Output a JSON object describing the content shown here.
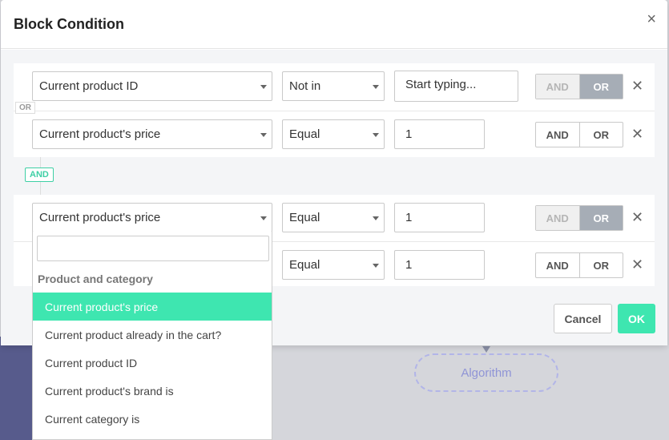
{
  "background": {
    "node_label": "Algorithm"
  },
  "modal": {
    "title": "Block Condition",
    "close_glyph": "×",
    "groups": [
      {
        "rows": [
          {
            "field": "Current product ID",
            "operator": "Not in",
            "value": "Start typing...",
            "and_label": "AND",
            "or_label": "OR",
            "remove_glyph": "✕"
          },
          {
            "field": "Current product's price",
            "operator": "Equal",
            "value": "1",
            "and_label": "AND",
            "or_label": "OR",
            "remove_glyph": "✕"
          }
        ],
        "inner_badge": "OR"
      },
      {
        "rows": [
          {
            "field": "Current product's price",
            "operator": "Equal",
            "value": "1",
            "and_label": "AND",
            "or_label": "OR",
            "remove_glyph": "✕"
          },
          {
            "field": "",
            "operator": "Equal",
            "value": "1",
            "and_label": "AND",
            "or_label": "OR",
            "remove_glyph": "✕"
          }
        ]
      }
    ],
    "between_badge": "AND",
    "cancel_label": "Cancel",
    "ok_label": "OK"
  },
  "dropdown": {
    "search_value": "",
    "group_label": "Product and category",
    "items": [
      "Current product's price",
      "Current product already in the cart?",
      "Current product ID",
      "Current product's brand is",
      "Current category is"
    ],
    "selected_index": 0
  },
  "colors": {
    "accent": "#3ee6b0",
    "active_toggle": "#a6adb6",
    "sidebar": "#575b8c"
  }
}
